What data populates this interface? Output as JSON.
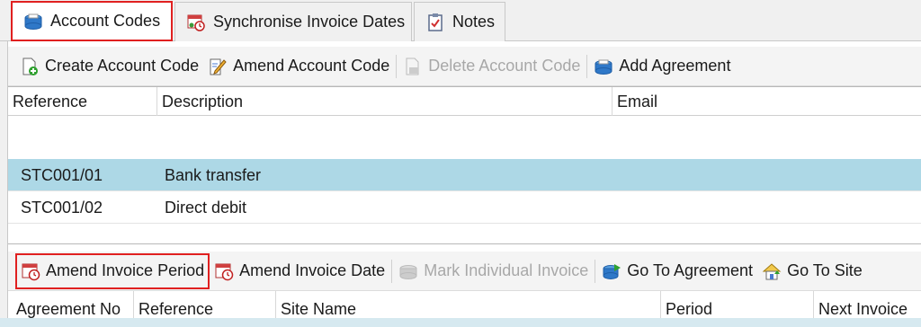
{
  "tabs": [
    {
      "label": "Account Codes",
      "icon": "folder-stack-icon",
      "active": true
    },
    {
      "label": "Synchronise Invoice Dates",
      "icon": "calendar-sync-icon",
      "active": false
    },
    {
      "label": "Notes",
      "icon": "notes-icon",
      "active": false
    }
  ],
  "top_toolbar": {
    "create": "Create Account Code",
    "amend": "Amend Account Code",
    "delete": "Delete Account Code",
    "add_agreement": "Add Agreement"
  },
  "account_grid": {
    "columns": [
      "Reference",
      "Description",
      "Email"
    ],
    "rows": [
      {
        "reference": "STC001/01",
        "description": "Bank transfer",
        "email": ""
      },
      {
        "reference": "STC001/02",
        "description": "Direct debit",
        "email": ""
      }
    ]
  },
  "bottom_toolbar": {
    "amend_period": "Amend Invoice Period",
    "amend_date": "Amend Invoice Date",
    "mark_individual": "Mark Individual Invoice",
    "go_agreement": "Go To Agreement",
    "go_site": "Go To Site"
  },
  "agreement_grid": {
    "columns": [
      "Agreement No",
      "Reference",
      "Site Name",
      "Period",
      "Next Invoice"
    ]
  },
  "colors": {
    "selection": "#add8e6",
    "highlight_outline": "#e02020",
    "disabled_text": "#a8a8a8"
  }
}
